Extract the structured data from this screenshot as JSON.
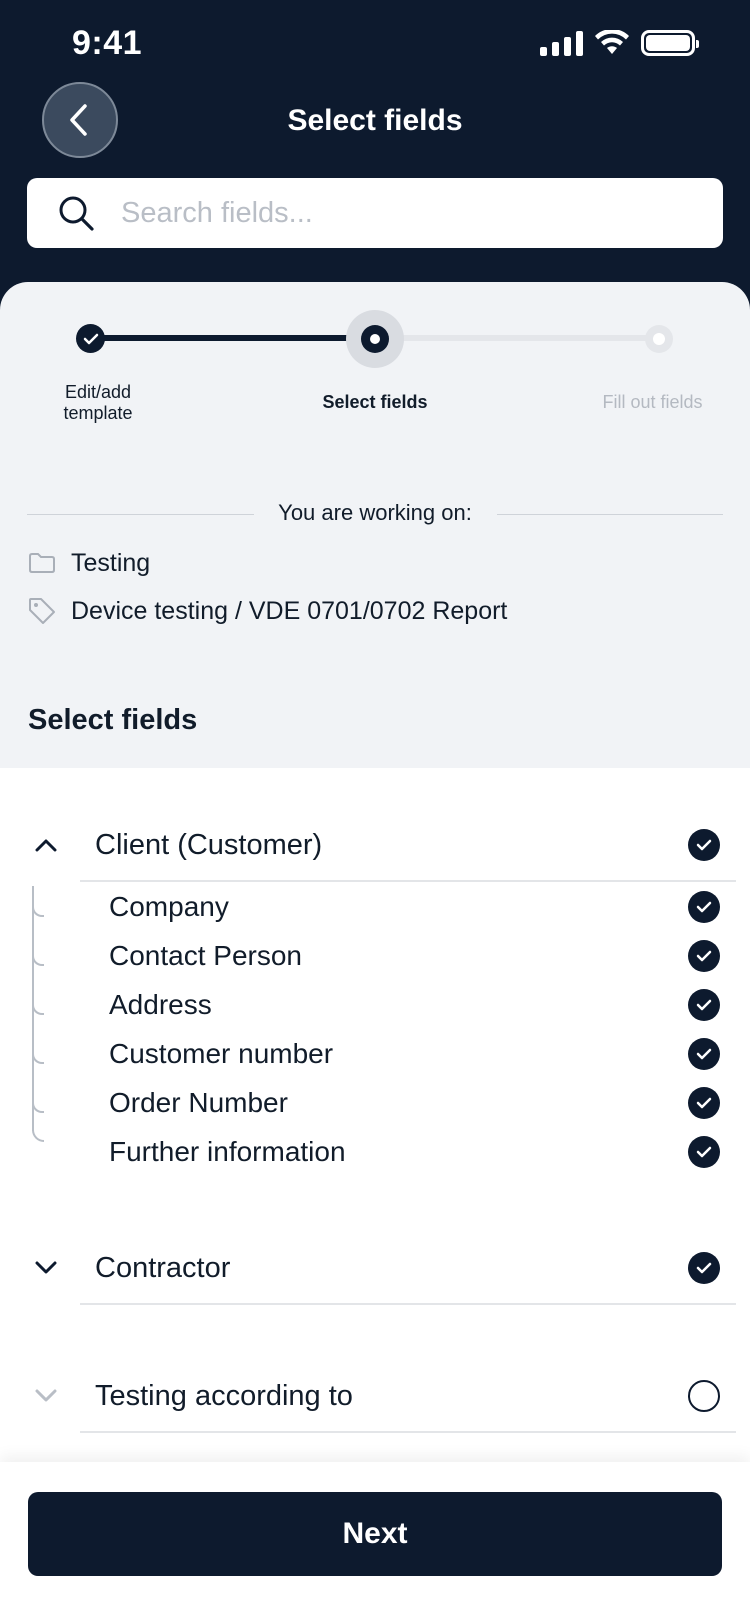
{
  "status_bar": {
    "time": "9:41"
  },
  "header": {
    "title": "Select fields"
  },
  "search": {
    "placeholder": "Search fields..."
  },
  "stepper": {
    "steps": [
      {
        "label_line1": "Edit/add",
        "label_line2": "template",
        "state": "done"
      },
      {
        "label": "Select fields",
        "state": "current"
      },
      {
        "label": "Fill out fields",
        "state": "todo"
      }
    ]
  },
  "context": {
    "heading": "You are working on:",
    "folder": "Testing",
    "template": "Device testing / VDE 0701/0702 Report"
  },
  "section_title": "Select fields",
  "groups": [
    {
      "label": "Client (Customer)",
      "expanded": true,
      "checked": true,
      "fields": [
        {
          "label": "Company",
          "checked": true
        },
        {
          "label": "Contact Person",
          "checked": true
        },
        {
          "label": "Address",
          "checked": true
        },
        {
          "label": "Customer number",
          "checked": true
        },
        {
          "label": "Order Number",
          "checked": true
        },
        {
          "label": "Further information",
          "checked": true
        }
      ]
    },
    {
      "label": "Contractor",
      "expanded": false,
      "checked": true
    },
    {
      "label": "Testing according to",
      "expanded": false,
      "checked": false
    }
  ],
  "footer": {
    "next_label": "Next"
  },
  "colors": {
    "primary": "#0d1a2e",
    "background": "#f1f3f6"
  }
}
